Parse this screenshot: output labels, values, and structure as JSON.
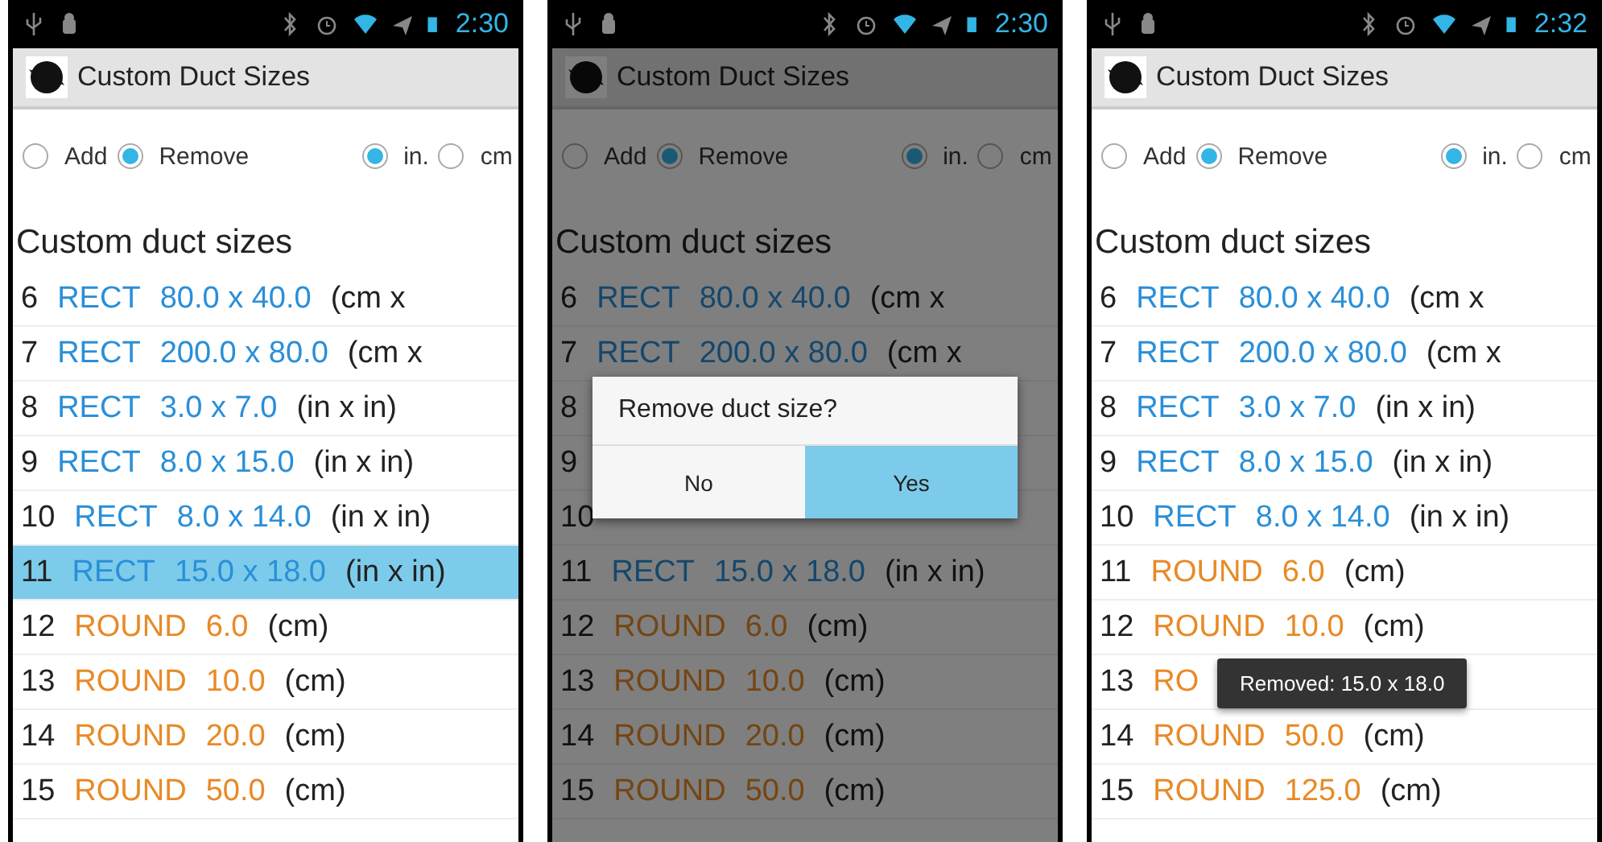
{
  "phones": [
    {
      "status_time": "2:30",
      "title": "Custom Duct Sizes",
      "mode_options": [
        {
          "label": "Add",
          "selected": false
        },
        {
          "label": "Remove",
          "selected": true
        }
      ],
      "unit_options": [
        {
          "label": "in.",
          "selected": true
        },
        {
          "label": "cm",
          "selected": false
        }
      ],
      "section_title": "Custom duct sizes",
      "rows": [
        {
          "index": "6",
          "kind": "rect",
          "shape": "RECT",
          "size": "80.0 x 40.0",
          "unit": "(cm x",
          "selected": false
        },
        {
          "index": "7",
          "kind": "rect",
          "shape": "RECT",
          "size": "200.0 x 80.0",
          "unit": "(cm x",
          "selected": false
        },
        {
          "index": "8",
          "kind": "rect",
          "shape": "RECT",
          "size": "3.0 x 7.0",
          "unit": "(in x in)",
          "selected": false
        },
        {
          "index": "9",
          "kind": "rect",
          "shape": "RECT",
          "size": "8.0 x 15.0",
          "unit": "(in x in)",
          "selected": false
        },
        {
          "index": "10",
          "kind": "rect",
          "shape": "RECT",
          "size": "8.0 x 14.0",
          "unit": "(in x in)",
          "selected": false
        },
        {
          "index": "11",
          "kind": "rect",
          "shape": "RECT",
          "size": "15.0 x 18.0",
          "unit": "(in x in)",
          "selected": true
        },
        {
          "index": "12",
          "kind": "round",
          "shape": "ROUND",
          "size": "6.0",
          "unit": "(cm)",
          "selected": false
        },
        {
          "index": "13",
          "kind": "round",
          "shape": "ROUND",
          "size": "10.0",
          "unit": "(cm)",
          "selected": false
        },
        {
          "index": "14",
          "kind": "round",
          "shape": "ROUND",
          "size": "20.0",
          "unit": "(cm)",
          "selected": false
        },
        {
          "index": "15",
          "kind": "round",
          "shape": "ROUND",
          "size": "50.0",
          "unit": "(cm)",
          "selected": false
        }
      ]
    },
    {
      "status_time": "2:30",
      "title": "Custom Duct Sizes",
      "mode_options": [
        {
          "label": "Add",
          "selected": false
        },
        {
          "label": "Remove",
          "selected": true
        }
      ],
      "unit_options": [
        {
          "label": "in.",
          "selected": true
        },
        {
          "label": "cm",
          "selected": false
        }
      ],
      "section_title": "Custom duct sizes",
      "rows": [
        {
          "index": "6",
          "kind": "rect",
          "shape": "RECT",
          "size": "80.0 x 40.0",
          "unit": "(cm x",
          "selected": false
        },
        {
          "index": "7",
          "kind": "rect",
          "shape": "RECT",
          "size": "200.0 x 80.0",
          "unit": "(cm x",
          "selected": false
        },
        {
          "index": "8",
          "selected": false
        },
        {
          "index": "9",
          "selected": false
        },
        {
          "index": "10",
          "selected": false
        },
        {
          "index": "11",
          "kind": "rect",
          "shape": "RECT",
          "size": "15.0 x 18.0",
          "unit": "(in x in)",
          "selected": false
        },
        {
          "index": "12",
          "kind": "round",
          "shape": "ROUND",
          "size": "6.0",
          "unit": "(cm)",
          "selected": false
        },
        {
          "index": "13",
          "kind": "round",
          "shape": "ROUND",
          "size": "10.0",
          "unit": "(cm)",
          "selected": false
        },
        {
          "index": "14",
          "kind": "round",
          "shape": "ROUND",
          "size": "20.0",
          "unit": "(cm)",
          "selected": false
        },
        {
          "index": "15",
          "kind": "round",
          "shape": "ROUND",
          "size": "50.0",
          "unit": "(cm)",
          "selected": false
        }
      ],
      "dialog": {
        "message": "Remove duct size?",
        "buttons": [
          {
            "label": "No",
            "selected": false
          },
          {
            "label": "Yes",
            "selected": true
          }
        ]
      }
    },
    {
      "status_time": "2:32",
      "title": "Custom Duct Sizes",
      "mode_options": [
        {
          "label": "Add",
          "selected": false
        },
        {
          "label": "Remove",
          "selected": true
        }
      ],
      "unit_options": [
        {
          "label": "in.",
          "selected": true
        },
        {
          "label": "cm",
          "selected": false
        }
      ],
      "section_title": "Custom duct sizes",
      "rows": [
        {
          "index": "6",
          "kind": "rect",
          "shape": "RECT",
          "size": "80.0 x 40.0",
          "unit": "(cm x",
          "selected": false
        },
        {
          "index": "7",
          "kind": "rect",
          "shape": "RECT",
          "size": "200.0 x 80.0",
          "unit": "(cm x",
          "selected": false
        },
        {
          "index": "8",
          "kind": "rect",
          "shape": "RECT",
          "size": "3.0 x 7.0",
          "unit": "(in x in)",
          "selected": false
        },
        {
          "index": "9",
          "kind": "rect",
          "shape": "RECT",
          "size": "8.0 x 15.0",
          "unit": "(in x in)",
          "selected": false
        },
        {
          "index": "10",
          "kind": "rect",
          "shape": "RECT",
          "size": "8.0 x 14.0",
          "unit": "(in x in)",
          "selected": false
        },
        {
          "index": "11",
          "kind": "round",
          "shape": "ROUND",
          "size": "6.0",
          "unit": "(cm)",
          "selected": false
        },
        {
          "index": "12",
          "kind": "round",
          "shape": "ROUND",
          "size": "10.0",
          "unit": "(cm)",
          "selected": false
        },
        {
          "index": "13",
          "kind": "round",
          "shape": "RO",
          "selected": false
        },
        {
          "index": "14",
          "kind": "round",
          "shape": "ROUND",
          "size": "50.0",
          "unit": "(cm)",
          "selected": false
        },
        {
          "index": "15",
          "kind": "round",
          "shape": "ROUND",
          "size": "125.0",
          "unit": "(cm)",
          "selected": false
        }
      ],
      "toast": "Removed: 15.0 x 18.0"
    }
  ]
}
